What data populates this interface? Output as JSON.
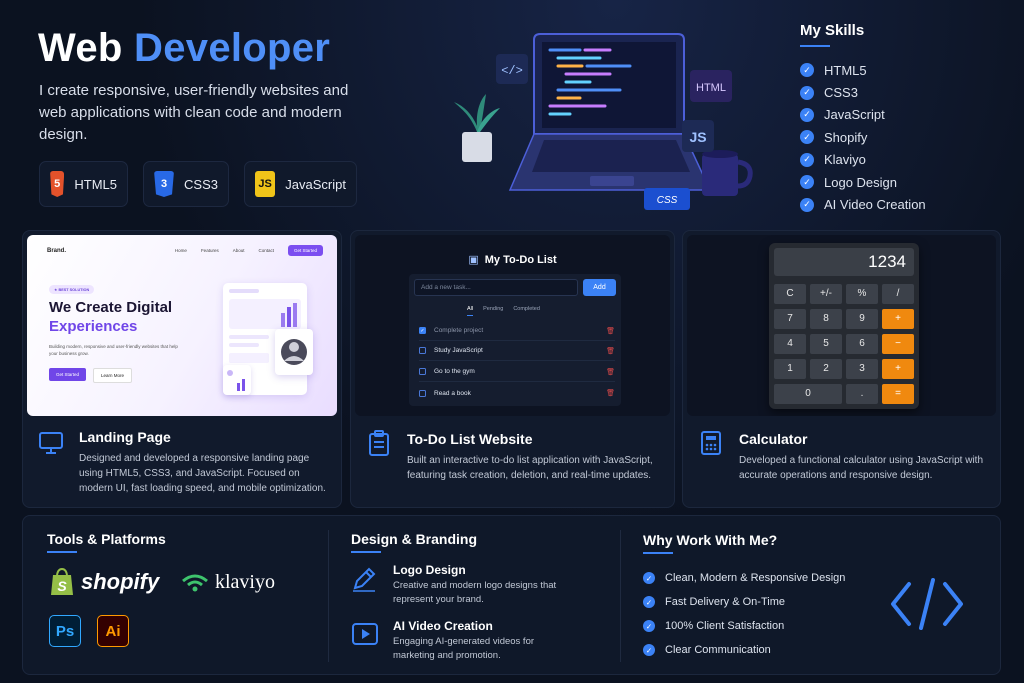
{
  "hero": {
    "title_part1": "Web",
    "title_part2": "Developer",
    "text": "I create responsive, user-friendly websites and web applications with clean code and modern design.",
    "chips": [
      {
        "label": "HTML5",
        "badge": "5",
        "color": "#e4522b"
      },
      {
        "label": "CSS3",
        "badge": "3",
        "color": "#2869e6"
      },
      {
        "label": "JavaScript",
        "badge": "JS",
        "color": "#f0c419"
      }
    ],
    "laptop_tags": [
      "</>",
      "HTML",
      "JS",
      "CSS"
    ]
  },
  "skills": {
    "title": "My Skills",
    "items": [
      "HTML5",
      "CSS3",
      "JavaScript",
      "Shopify",
      "Klaviyo",
      "Logo Design",
      "AI Video Creation"
    ]
  },
  "projects": [
    {
      "title": "Landing Page",
      "desc": "Designed and developed a responsive landing page using HTML5, CSS3, and JavaScript. Focused on modern UI, fast loading speed, and mobile optimization.",
      "icon": "monitor-icon"
    },
    {
      "title": "To-Do List Website",
      "desc": "Built an interactive to-do list application with JavaScript, featuring task creation, deletion, and real-time updates.",
      "icon": "clipboard-icon"
    },
    {
      "title": "Calculator",
      "desc": "Developed a functional calculator using JavaScript with accurate operations and responsive design.",
      "icon": "calculator-icon"
    }
  ],
  "landing_preview": {
    "brand": "Brand.",
    "nav": [
      "Home",
      "Features",
      "About",
      "Contact"
    ],
    "nav_button": "Get Started",
    "badge": "★ BEST SOLUTION",
    "headline_1": "We Create Digital",
    "headline_2": "Experiences",
    "sub": "Building modern, responsive and user-friendly websites that help your business grow.",
    "btn_primary": "Get Started",
    "btn_secondary": "Learn More"
  },
  "todo_preview": {
    "title": "My To-Do List",
    "placeholder": "Add a new task...",
    "add": "Add",
    "tabs": [
      "All",
      "Pending",
      "Completed"
    ],
    "tasks": [
      {
        "text": "Complete project",
        "done": true
      },
      {
        "text": "Study JavaScript",
        "done": false
      },
      {
        "text": "Go to the gym",
        "done": false
      },
      {
        "text": "Read a book",
        "done": false
      }
    ]
  },
  "calc_preview": {
    "display": "1234",
    "keys": [
      [
        "C",
        "+/-",
        "%",
        "/"
      ],
      [
        "7",
        "8",
        "9",
        "+"
      ],
      [
        "4",
        "5",
        "6",
        "−"
      ],
      [
        "1",
        "2",
        "3",
        "+"
      ],
      [
        "0",
        ".",
        "="
      ]
    ],
    "accent": "#f0890f"
  },
  "tools": {
    "title": "Tools & Platforms",
    "shopify": "shopify",
    "klaviyo": "klaviyo",
    "ps": "Ps",
    "ai": "Ai"
  },
  "design": {
    "title": "Design & Branding",
    "items": [
      {
        "title": "Logo Design",
        "desc": "Creative and modern logo designs that represent your brand."
      },
      {
        "title": "AI Video Creation",
        "desc": "Engaging AI-generated videos for marketing and promotion."
      }
    ]
  },
  "why": {
    "title": "Why Work With Me?",
    "items": [
      "Clean, Modern & Responsive Design",
      "Fast Delivery & On-Time",
      "100% Client Satisfaction",
      "Clear Communication"
    ]
  },
  "colors": {
    "accent": "#3b82f6",
    "background": "#0b1220",
    "card": "#111a2c"
  }
}
